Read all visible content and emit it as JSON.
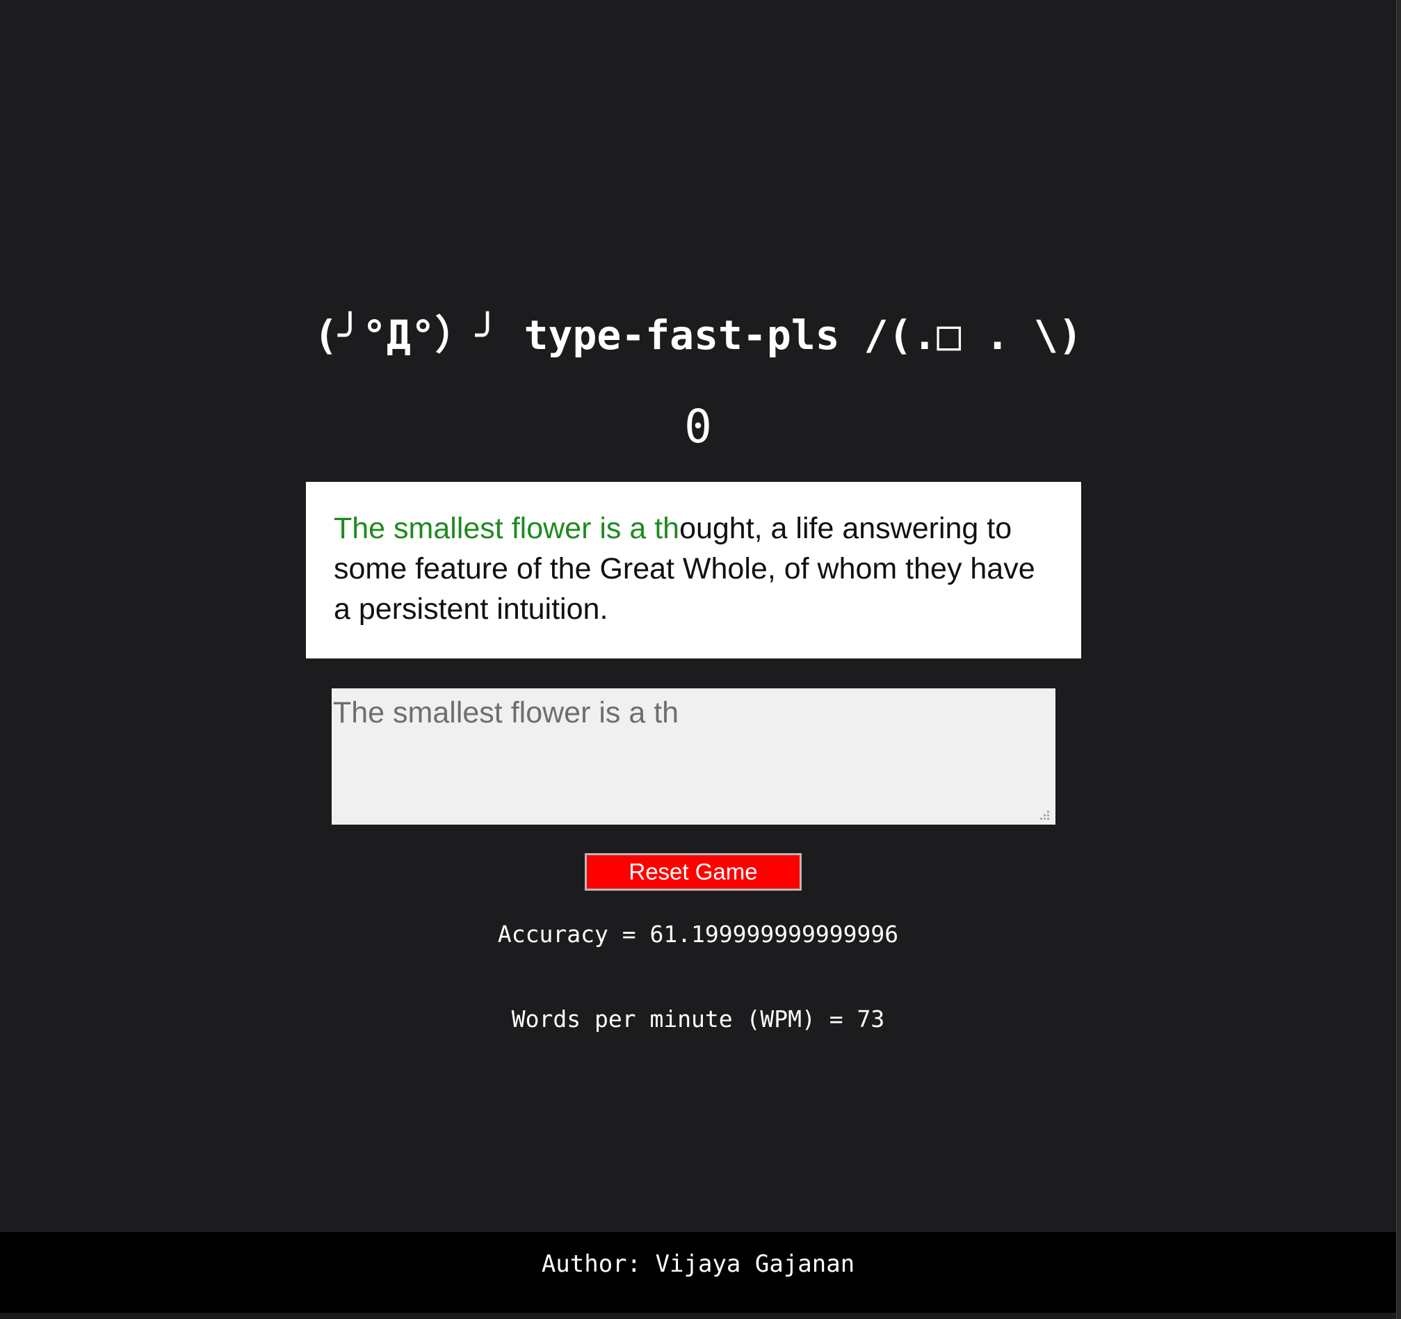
{
  "header": {
    "title": "(╯°Д°）╯  type-fast-pls /(.□ . \\)"
  },
  "timer": {
    "value": "0"
  },
  "quote": {
    "typed_correct": "The smallest flower is a th",
    "remaining": "ought, a life answering to some feature of the Great Whole, of whom they have a persistent intuition."
  },
  "input": {
    "value": "The smallest flower is a th"
  },
  "controls": {
    "reset_label": "Reset Game"
  },
  "stats": {
    "accuracy": "Accuracy = 61.199999999999996",
    "wpm": "Words per minute (WPM) = 73"
  },
  "footer": {
    "author": "Author: Vijaya Gajanan"
  },
  "colors": {
    "background": "#1c1c1e",
    "correct_text": "#1f8a1f",
    "reset_button": "#ff0000",
    "footer_background": "#000000"
  }
}
